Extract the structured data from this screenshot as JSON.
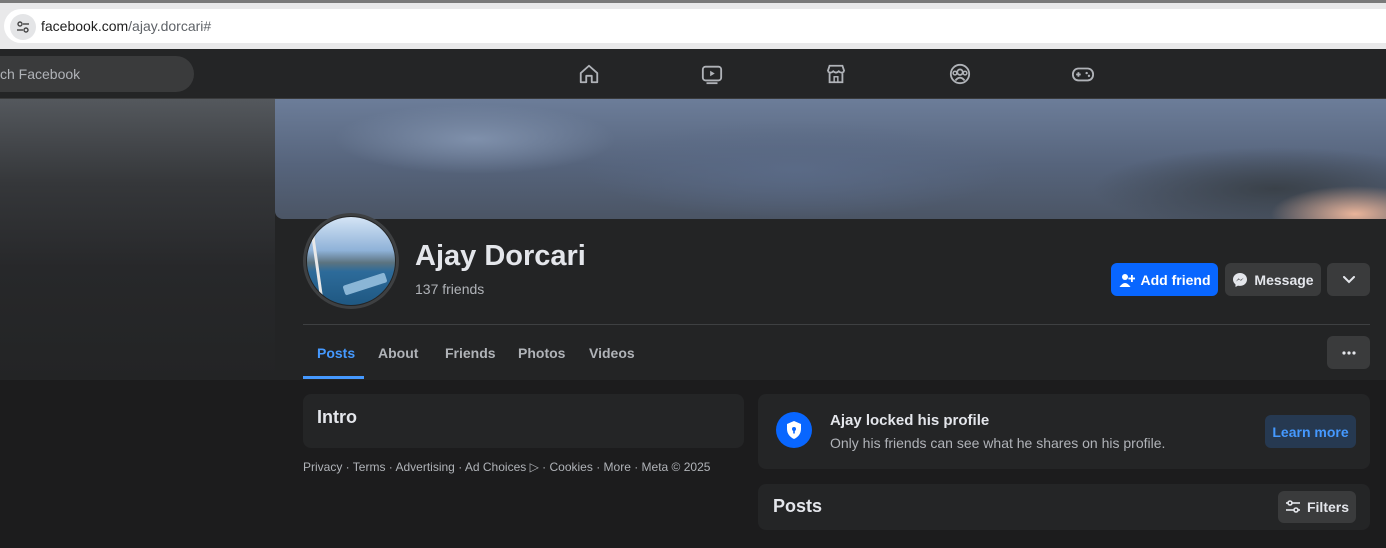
{
  "browser": {
    "url_host": "facebook.com",
    "url_path": "/ajay.dorcari#"
  },
  "topbar": {
    "search_placeholder": "ch Facebook",
    "nav_icons": [
      "home-icon",
      "video-icon",
      "marketplace-icon",
      "groups-icon",
      "gaming-icon"
    ]
  },
  "profile": {
    "name": "Ajay Dorcari",
    "friends": "137 friends",
    "add_friend_label": "Add friend",
    "message_label": "Message"
  },
  "tabs": [
    {
      "label": "Posts",
      "active": true
    },
    {
      "label": "About"
    },
    {
      "label": "Friends"
    },
    {
      "label": "Photos"
    },
    {
      "label": "Videos"
    }
  ],
  "intro": {
    "title": "Intro"
  },
  "footer": {
    "privacy": "Privacy",
    "terms": "Terms",
    "advertising": "Advertising",
    "ad_choices": "Ad Choices",
    "cookies": "Cookies",
    "more": "More",
    "copyright": "Meta © 2025"
  },
  "locked": {
    "title": "Ajay locked his profile",
    "subtitle": "Only his friends can see what he shares on his profile.",
    "learn_more": "Learn more"
  },
  "posts": {
    "title": "Posts",
    "filters_label": "Filters"
  },
  "colors": {
    "accent": "#0866ff",
    "link_blue": "#4599ff",
    "surface": "#242526",
    "background": "#1c1c1d"
  }
}
